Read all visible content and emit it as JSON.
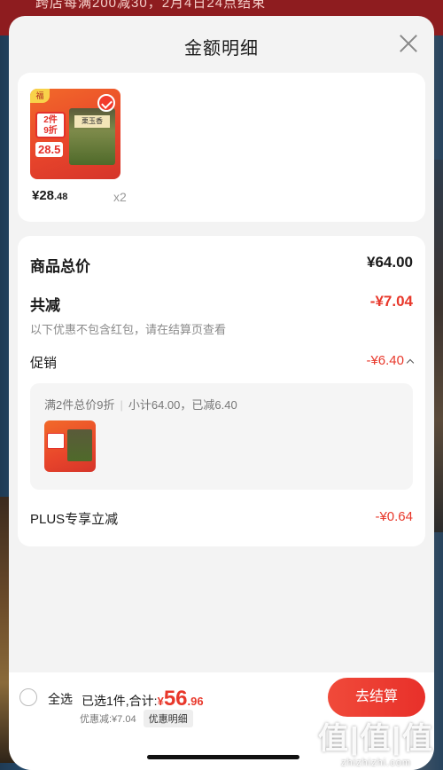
{
  "background": {
    "banner_text": "跨店每满200减30，2月4日24点结束"
  },
  "sheet": {
    "title": "金额明细",
    "close_icon": "close-icon"
  },
  "product": {
    "thumb_badge": "福",
    "thumb_tag_line1": "2件",
    "thumb_tag_line2": "9折",
    "thumb_price": "28.5",
    "thumb_pack_label": "栗玉香",
    "price_main": "¥28",
    "price_cents": ".48",
    "quantity": "x2",
    "selected": true
  },
  "summary": {
    "goods_total_label": "商品总价",
    "goods_total_value": "¥64.00",
    "total_reduce_label": "共减",
    "total_reduce_value": "-¥7.04",
    "note": "以下优惠不包含红包，请在结算页查看",
    "promo_label": "促销",
    "promo_value": "-¥6.40",
    "promo_detail": {
      "rule": "满2件总价9折",
      "subtotal": "小计64.00，已减6.40"
    },
    "plus_label": "PLUS专享立减",
    "plus_value": "-¥0.64"
  },
  "footer": {
    "select_all_label": "全选",
    "selected_prefix": "已选1件,合计:",
    "total_yen": "¥",
    "total_big": "56",
    "total_cents": ".96",
    "discount_text": "优惠减:¥7.04",
    "detail_button": "优惠明细",
    "checkout_button": "去结算"
  },
  "watermark": {
    "logo": "值|值|值",
    "url": "zhizhizhi.com"
  },
  "colors": {
    "accent_red": "#e8382b",
    "sheet_bg": "#f3f3f3",
    "card_bg": "#ffffff"
  }
}
